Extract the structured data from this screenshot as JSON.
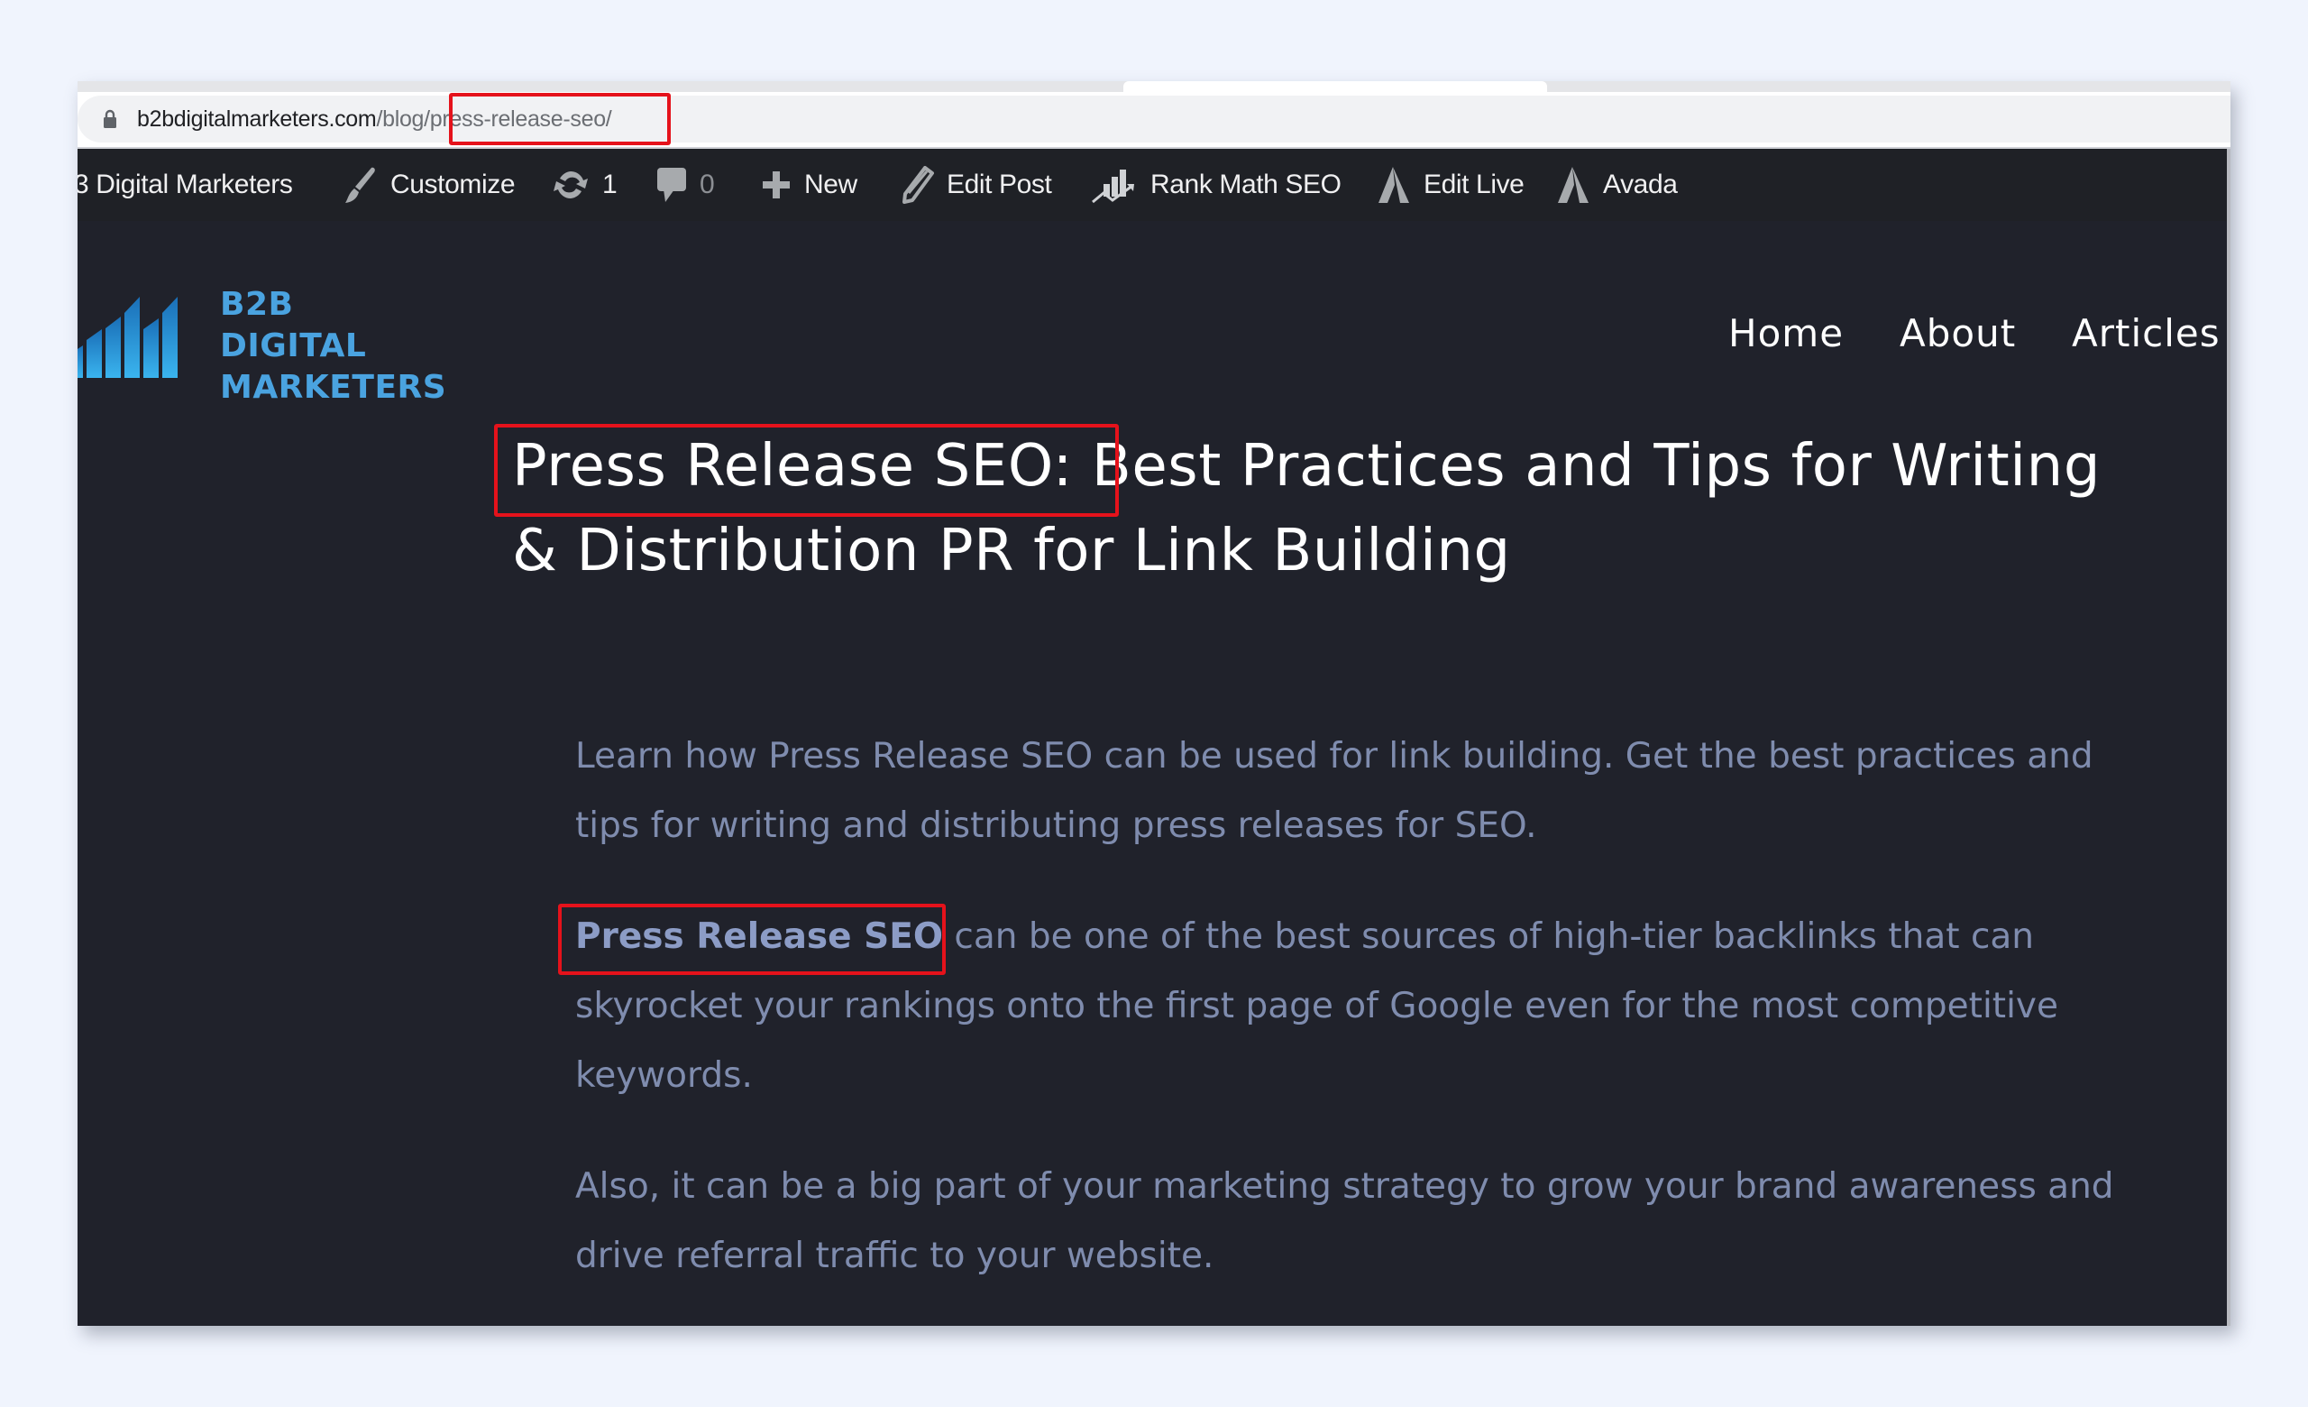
{
  "browser": {
    "url_domain": "b2bdigitalmarketers.com",
    "url_path": "/blog/press-release-seo/",
    "lock_icon": "lock-icon"
  },
  "admin_bar": {
    "site_name": "3 Digital Marketers",
    "items": [
      {
        "icon": "paintbrush-icon",
        "label": "Customize"
      },
      {
        "icon": "sync-icon",
        "label": "1"
      },
      {
        "icon": "comment-icon",
        "label": "0"
      },
      {
        "icon": "plus-icon",
        "label": "New"
      },
      {
        "icon": "pencil-icon",
        "label": "Edit Post"
      },
      {
        "icon": "rank-math-icon",
        "label": "Rank Math SEO"
      },
      {
        "icon": "avada-icon",
        "label": "Edit Live"
      },
      {
        "icon": "avada-icon",
        "label": "Avada"
      }
    ]
  },
  "site": {
    "logo_line1": "B2B DIGITAL",
    "logo_line2": "MARKETERS",
    "nav": [
      "Home",
      "About",
      "Articles"
    ]
  },
  "article": {
    "title_highlight": "Press Release SEO:",
    "title_rest": " Best Practices and Tips for Writing & Distribution PR for Link Building",
    "paragraphs": [
      {
        "text": "Learn how Press Release SEO can be used for link building. Get the best practices and tips for writing and distributing press releases for SEO."
      },
      {
        "bold": "Press Release SEO",
        "text": " can be one of the best sources of high-tier backlinks that can skyrocket your rankings onto the first page of Google even for the most competitive keywords."
      },
      {
        "text": "Also, it can be a big part of your marketing strategy to grow your brand awareness and drive referral traffic to your website."
      }
    ]
  },
  "colors": {
    "page_background": "#f0f4fd",
    "site_background": "#20222b",
    "admin_bar": "#1f2126",
    "highlight_box": "#e5121b",
    "logo_blue": "#4aa3e0",
    "body_text": "#7f8cae"
  }
}
